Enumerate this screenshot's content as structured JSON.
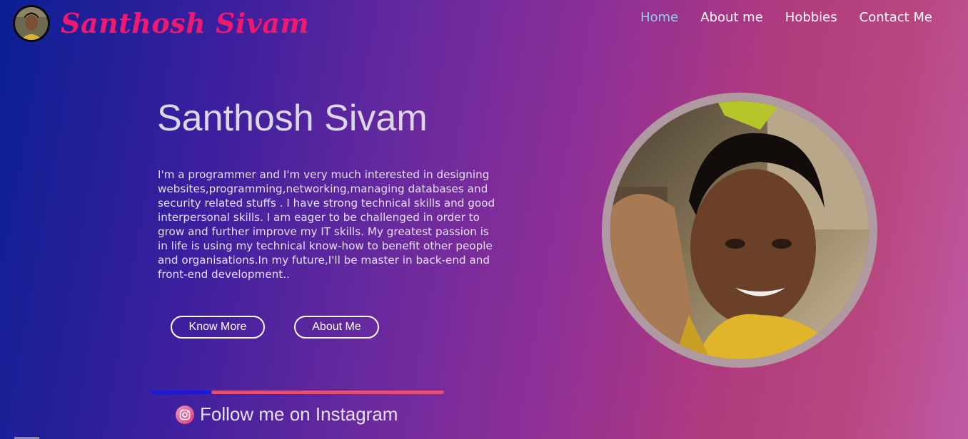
{
  "header": {
    "logo_title": "Santhosh Sivam",
    "nav": [
      {
        "label": "Home",
        "active": true
      },
      {
        "label": "About me",
        "active": false
      },
      {
        "label": "Hobbies",
        "active": false
      },
      {
        "label": "Contact Me",
        "active": false
      }
    ]
  },
  "hero": {
    "name": "Santhosh Sivam",
    "bio": "I'm a programmer and I'm very much interested in designing websites,programming,networking,managing databases and security related stuffs . I have strong technical skills and good interpersonal skills. I am eager to be challenged in order to grow and further improve my IT skills. My greatest passion is in life is using my technical know-how to benefit other people and organisations.In my future,I'll be master in back-end and front-end development..",
    "buttons": {
      "know_more": "Know More",
      "about_me": "About Me"
    },
    "instagram_label": "Follow me on Instagram"
  },
  "icons": {
    "instagram": "instagram-icon",
    "avatar": "avatar",
    "portrait": "profile-portrait"
  },
  "colors": {
    "logo": "#f0186f",
    "nav_active": "#8fd3e8",
    "portrait_ring": "#b09aa2"
  }
}
